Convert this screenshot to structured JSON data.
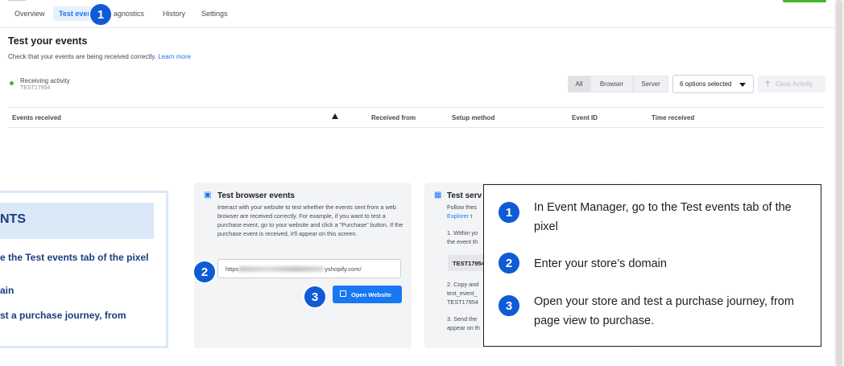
{
  "tabs": [
    "Overview",
    "Test ever",
    "agnostics",
    "History",
    "Settings"
  ],
  "header": {
    "title": "Test your events",
    "subtitle": "Check that your events are being received correctly.",
    "learn_more": "Learn more"
  },
  "status": {
    "label": "Receiving activity",
    "code": "TEST17954"
  },
  "filters": {
    "all": "All",
    "browser": "Browser",
    "server": "Server",
    "dropdown": "6 options selected",
    "clear": "Clear Activity"
  },
  "table": {
    "columns": [
      "Events received",
      "Received from",
      "Setup method",
      "Event ID",
      "Time received"
    ]
  },
  "left_panel": {
    "title": "NTS",
    "line1": "e the Test events tab of the pixel",
    "line2": "ain",
    "line3": "st a purchase journey, from"
  },
  "browser_card": {
    "title": "Test browser events",
    "body": "Interact with your website to test whether the events sent from a web browser are received correctly. For example, if you want to test a purchase event, go to your website and click a \"Purchase\" button. If the purchase event is received, it'll appear on this screen.",
    "url_prefix": "https",
    "url_suffix": "yshopify.com/",
    "button": "Open Website"
  },
  "server_card": {
    "title": "Test serv",
    "l1": "Follow thes",
    "l2": "Explorer",
    "l2b": "t",
    "l3": "1. Within yo",
    "l4": "the event th",
    "code": "TEST17954",
    "l5": "2. Copy and",
    "l6": "test_event_",
    "l7": "TEST17954",
    "l8": "3. Send the",
    "l9": "appear on th"
  },
  "badges": [
    "1",
    "2",
    "3"
  ],
  "overlay": {
    "steps": [
      {
        "num": "1",
        "text": "In Event Manager, go to the Test events tab of the pixel"
      },
      {
        "num": "2",
        "text": "Enter your store’s domain"
      },
      {
        "num": "3",
        "text": "Open your store and test a purchase journey, from page view to purchase."
      }
    ]
  },
  "colors": {
    "accent": "#1877f2",
    "badge": "#0f5bd6",
    "panel": "#dbe8f8",
    "panel_text": "#1a3d7c",
    "status_green": "#42b72a"
  }
}
